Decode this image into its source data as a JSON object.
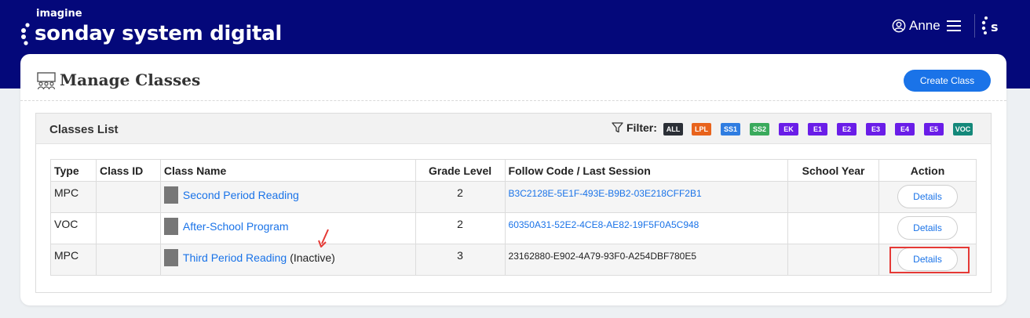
{
  "brand": {
    "top": "imagine",
    "name": "sonday system digital"
  },
  "user": {
    "name": "Anne"
  },
  "icons": {
    "user": "user-circle-icon",
    "menu": "hamburger-menu-icon",
    "brand_mark": "sonday-s-logo-icon",
    "classroom": "classroom-icon",
    "filter": "filter-funnel-icon",
    "arrow": "red-arrow-annotation"
  },
  "page": {
    "title": "Manage Classes",
    "create_label": "Create Class"
  },
  "panel": {
    "title": "Classes List",
    "filter_label": "Filter:"
  },
  "filters": [
    {
      "label": "ALL",
      "color": "#2b2f36"
    },
    {
      "label": "LPL",
      "color": "#e8631c"
    },
    {
      "label": "SS1",
      "color": "#2f7de1"
    },
    {
      "label": "SS2",
      "color": "#3aaa5c"
    },
    {
      "label": "EK",
      "color": "#6a1de8"
    },
    {
      "label": "E1",
      "color": "#6a1de8"
    },
    {
      "label": "E2",
      "color": "#6a1de8"
    },
    {
      "label": "E3",
      "color": "#6a1de8"
    },
    {
      "label": "E4",
      "color": "#6a1de8"
    },
    {
      "label": "E5",
      "color": "#6a1de8"
    },
    {
      "label": "VOC",
      "color": "#14887a"
    }
  ],
  "table": {
    "headers": [
      "Type",
      "Class ID",
      "Class Name",
      "Grade Level",
      "Follow Code / Last Session",
      "School Year",
      "Action"
    ],
    "rows": [
      {
        "type": "MPC",
        "class_id": "",
        "name": "Second Period Reading",
        "status": "",
        "grade": "2",
        "code": "B3C2128E-5E1F-493E-B9B2-03E218CFF2B1",
        "year": "",
        "action": "Details"
      },
      {
        "type": "VOC",
        "class_id": "",
        "name": "After-School Program",
        "status": "",
        "grade": "2",
        "code": "60350A31-52E2-4CE8-AE82-19F5F0A5C948",
        "year": "",
        "action": "Details"
      },
      {
        "type": "MPC",
        "class_id": "",
        "name": "Third Period Reading",
        "status": "(Inactive)",
        "grade": "3",
        "code": "23162880-E902-4A79-93F0-A254DBF780E5",
        "year": "",
        "action": "Details"
      }
    ]
  },
  "colors": {
    "header_bg": "#04087a",
    "accent": "#1a73e8",
    "highlight": "#e53935"
  }
}
